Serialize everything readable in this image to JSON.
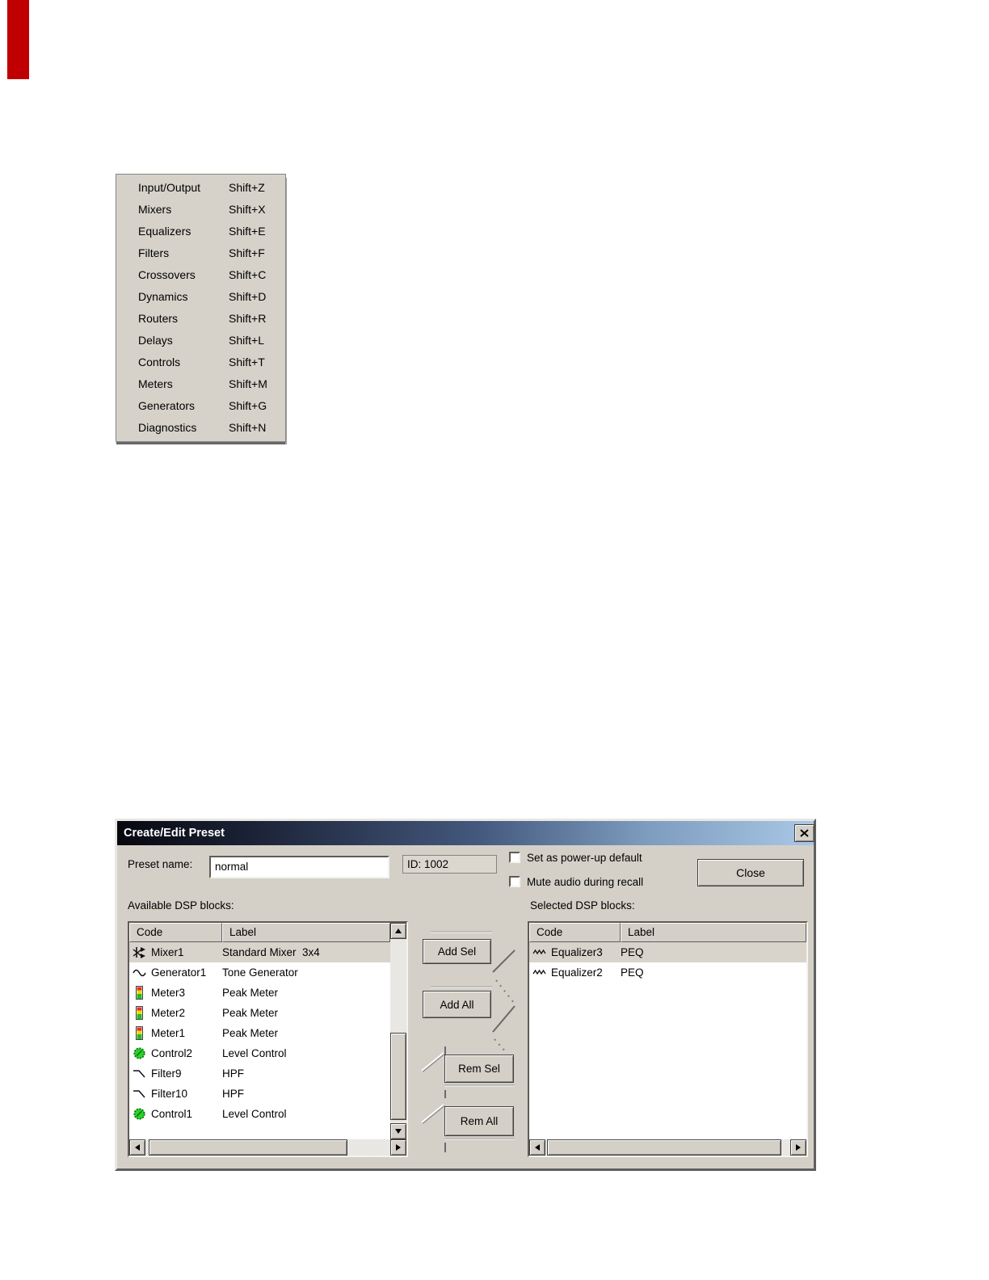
{
  "page": {
    "background": "#ffffff",
    "red_marker_color": "#c00000"
  },
  "menu": {
    "items": [
      {
        "label": "Input/Output",
        "shortcut": "Shift+Z"
      },
      {
        "label": "Mixers",
        "shortcut": "Shift+X"
      },
      {
        "label": "Equalizers",
        "shortcut": "Shift+E"
      },
      {
        "label": "Filters",
        "shortcut": "Shift+F"
      },
      {
        "label": "Crossovers",
        "shortcut": "Shift+C"
      },
      {
        "label": "Dynamics",
        "shortcut": "Shift+D"
      },
      {
        "label": "Routers",
        "shortcut": "Shift+R"
      },
      {
        "label": "Delays",
        "shortcut": "Shift+L"
      },
      {
        "label": "Controls",
        "shortcut": "Shift+T"
      },
      {
        "label": "Meters",
        "shortcut": "Shift+M"
      },
      {
        "label": "Generators",
        "shortcut": "Shift+G"
      },
      {
        "label": "Diagnostics",
        "shortcut": "Shift+N"
      }
    ]
  },
  "dialog": {
    "title": "Create/Edit Preset",
    "preset_name_label": "Preset name:",
    "preset_name_value": "normal",
    "id_text": "ID: 1002",
    "checkbox_power_label": "Set as power-up default",
    "checkbox_mute_label": "Mute audio during recall",
    "close_label": "Close",
    "available_label": "Available DSP blocks:",
    "selected_label": "Selected DSP blocks:",
    "columns": {
      "code": "Code",
      "label": "Label"
    },
    "buttons": {
      "add_sel": "Add Sel",
      "add_all": "Add All",
      "rem_sel": "Rem Sel",
      "rem_all": "Rem All"
    },
    "available_rows": [
      {
        "icon": "mixer",
        "code": "Mixer1",
        "label": "Standard Mixer  3x4",
        "selected": true
      },
      {
        "icon": "generator",
        "code": "Generator1",
        "label": "Tone Generator",
        "selected": false
      },
      {
        "icon": "meter",
        "code": "Meter3",
        "label": "Peak Meter",
        "selected": false
      },
      {
        "icon": "meter",
        "code": "Meter2",
        "label": "Peak Meter",
        "selected": false
      },
      {
        "icon": "meter",
        "code": "Meter1",
        "label": "Peak Meter",
        "selected": false
      },
      {
        "icon": "control",
        "code": "Control2",
        "label": "Level Control",
        "selected": false
      },
      {
        "icon": "filter",
        "code": "Filter9",
        "label": "HPF",
        "selected": false
      },
      {
        "icon": "filter",
        "code": "Filter10",
        "label": "HPF",
        "selected": false
      },
      {
        "icon": "control",
        "code": "Control1",
        "label": "Level Control",
        "selected": false
      }
    ],
    "selected_rows": [
      {
        "icon": "equalizer",
        "code": "Equalizer3",
        "label": "PEQ",
        "selected": true
      },
      {
        "icon": "equalizer",
        "code": "Equalizer2",
        "label": "PEQ",
        "selected": false
      }
    ]
  },
  "colors": {
    "dialog_bg": "#d4d0c8",
    "titlebar_gradient_left": "#07070f",
    "titlebar_gradient_right": "#a9c7e6",
    "selected_row_bg": "#d8d4cc",
    "meter_red": "#e03030",
    "meter_yellow": "#ecd800",
    "meter_green": "#28b828",
    "control_green": "#2ad22a"
  }
}
